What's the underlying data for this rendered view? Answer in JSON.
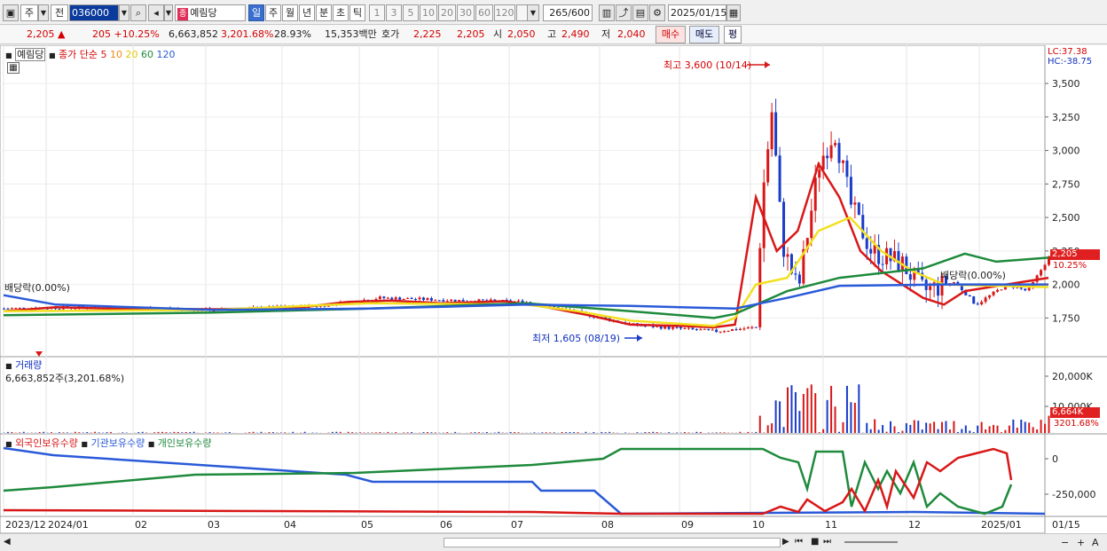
{
  "toolbar": {
    "period_main": "주",
    "period_prev": "전",
    "code": "036000",
    "name_tag": "종",
    "name": "예림당",
    "periods": [
      "일",
      "주",
      "월",
      "년",
      "분",
      "초",
      "틱"
    ],
    "minutes": [
      "1",
      "3",
      "5",
      "10",
      "20",
      "30",
      "60",
      "120"
    ],
    "count": "265",
    "count_total": "/600",
    "date": "2025/01/15"
  },
  "info": {
    "price": "2,205",
    "arrow": "▲",
    "change": "205",
    "change_pct": "+10.25%",
    "volume": "6,663,852",
    "volume_pct": "3,201.68%",
    "turnover": "28.93%",
    "amount": "15,353백만",
    "quote_label": "호가",
    "ask": "2,225",
    "bid": "2,205",
    "open_label": "시",
    "open": "2,050",
    "high_label": "고",
    "high": "2,490",
    "low_label": "저",
    "low": "2,040",
    "buy_label": "매수",
    "sell_label": "매도",
    "avg_label": "평"
  },
  "price_panel": {
    "name": "예림당",
    "legend_label": "종가 단순",
    "ma_periods": [
      "5",
      "10",
      "20",
      "60",
      "120"
    ],
    "ma_colors": [
      "#d81818",
      "#f08a10",
      "#f2e020",
      "#1e8a3c",
      "#2a5ad8"
    ],
    "lc": "LC:37.38",
    "hc": "HC:-38.75",
    "y_ticks": [
      "3,500",
      "3,250",
      "3,000",
      "2,750",
      "2,500",
      "2,250",
      "2,000",
      "1,750"
    ],
    "current_price_tag": "2,205",
    "current_pct_tag": "10.25%",
    "high_note": "최고 3,600 (10/14)",
    "low_note": "최저 1,605 (08/19)",
    "dividend_left": "배당락(0.00%)",
    "dividend_right": "배당락(0.00%)"
  },
  "volume_panel": {
    "title": "거래량",
    "value": "6,663,852주(3,201.68%)",
    "y_ticks": [
      "20,000K",
      "10,000K"
    ],
    "current_tag": "6,664K",
    "current_pct_tag": "3201.68%"
  },
  "holding_panel": {
    "series": [
      "외국인보유수량",
      "기관보유수량",
      "개인보유수량"
    ],
    "series_colors": [
      "#d81818",
      "#2a5ad8",
      "#1e8a3c"
    ],
    "y_ticks": [
      "0",
      "-250,000"
    ]
  },
  "x_axis": {
    "labels": [
      "2023/12",
      "2024/01",
      "02",
      "03",
      "04",
      "05",
      "06",
      "07",
      "08",
      "09",
      "10",
      "11",
      "12",
      "2025/01"
    ],
    "right_label": "01/15"
  },
  "scroll": {
    "controls": [
      "▶",
      "⏮",
      "■",
      "⏭"
    ]
  },
  "chart_data": {
    "type": "candlestick",
    "y_range": [
      1600,
      3600
    ],
    "highest": 3600,
    "lowest": 1605,
    "last_close": 2205,
    "ma_series": [
      {
        "name": "5",
        "points": [
          [
            0,
            1800
          ],
          [
            0.05,
            1830
          ],
          [
            0.1,
            1820
          ],
          [
            0.2,
            1815
          ],
          [
            0.28,
            1825
          ],
          [
            0.33,
            1870
          ],
          [
            0.37,
            1880
          ],
          [
            0.42,
            1860
          ],
          [
            0.48,
            1875
          ],
          [
            0.52,
            1830
          ],
          [
            0.56,
            1770
          ],
          [
            0.6,
            1700
          ],
          [
            0.65,
            1690
          ],
          [
            0.68,
            1680
          ],
          [
            0.7,
            1700
          ],
          [
            0.72,
            2650
          ],
          [
            0.74,
            2250
          ],
          [
            0.76,
            2400
          ],
          [
            0.78,
            2900
          ],
          [
            0.8,
            2650
          ],
          [
            0.82,
            2250
          ],
          [
            0.84,
            2100
          ],
          [
            0.86,
            2000
          ],
          [
            0.88,
            1900
          ],
          [
            0.9,
            1850
          ],
          [
            0.92,
            1950
          ],
          [
            1,
            2050
          ]
        ]
      },
      {
        "name": "20",
        "points": [
          [
            0,
            1800
          ],
          [
            0.2,
            1810
          ],
          [
            0.35,
            1860
          ],
          [
            0.5,
            1850
          ],
          [
            0.55,
            1800
          ],
          [
            0.6,
            1730
          ],
          [
            0.68,
            1690
          ],
          [
            0.7,
            1750
          ],
          [
            0.72,
            2000
          ],
          [
            0.75,
            2050
          ],
          [
            0.78,
            2400
          ],
          [
            0.81,
            2500
          ],
          [
            0.84,
            2250
          ],
          [
            0.87,
            2100
          ],
          [
            0.9,
            2000
          ],
          [
            1,
            1980
          ]
        ]
      },
      {
        "name": "60",
        "points": [
          [
            0,
            1770
          ],
          [
            0.2,
            1790
          ],
          [
            0.35,
            1820
          ],
          [
            0.5,
            1860
          ],
          [
            0.6,
            1800
          ],
          [
            0.68,
            1750
          ],
          [
            0.7,
            1780
          ],
          [
            0.75,
            1950
          ],
          [
            0.8,
            2050
          ],
          [
            0.88,
            2120
          ],
          [
            0.92,
            2230
          ],
          [
            0.95,
            2170
          ],
          [
            1,
            2200
          ]
        ]
      },
      {
        "name": "120",
        "points": [
          [
            0,
            1920
          ],
          [
            0.05,
            1850
          ],
          [
            0.2,
            1810
          ],
          [
            0.35,
            1820
          ],
          [
            0.5,
            1850
          ],
          [
            0.6,
            1840
          ],
          [
            0.7,
            1820
          ],
          [
            0.75,
            1900
          ],
          [
            0.8,
            1990
          ],
          [
            0.9,
            2000
          ],
          [
            1,
            2000
          ]
        ]
      }
    ]
  }
}
